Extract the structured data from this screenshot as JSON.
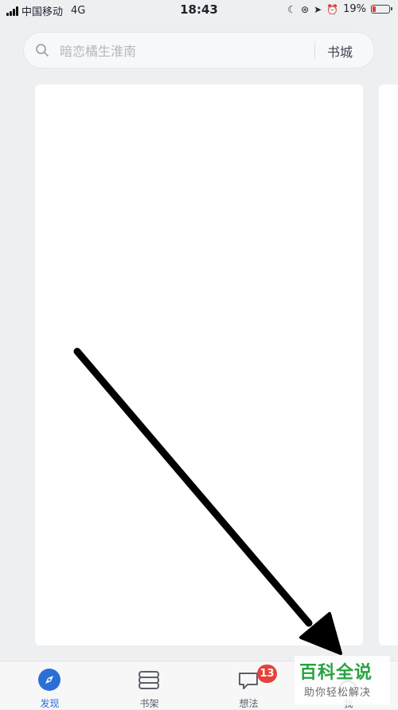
{
  "status_bar": {
    "carrier": "中国移动",
    "network": "4G",
    "time": "18:43",
    "battery": "19%",
    "battery_color": "#e53935"
  },
  "search": {
    "placeholder": "暗恋橘生淮南",
    "store_label": "书城",
    "icon": "search-icon"
  },
  "nav": {
    "active_color": "#2b6fd6",
    "items": [
      {
        "label": "发现",
        "icon": "compass-icon",
        "active": true
      },
      {
        "label": "书架",
        "icon": "bookshelf-icon",
        "active": false
      },
      {
        "label": "想法",
        "icon": "chat-bubble-icon",
        "active": false,
        "badge": "13"
      },
      {
        "label": "我",
        "icon": "profile-icon",
        "active": false
      }
    ]
  },
  "watermark": {
    "title": "百科全说",
    "subtitle": "助你轻松解决"
  },
  "annotation": {
    "type": "arrow",
    "color": "#000000"
  }
}
